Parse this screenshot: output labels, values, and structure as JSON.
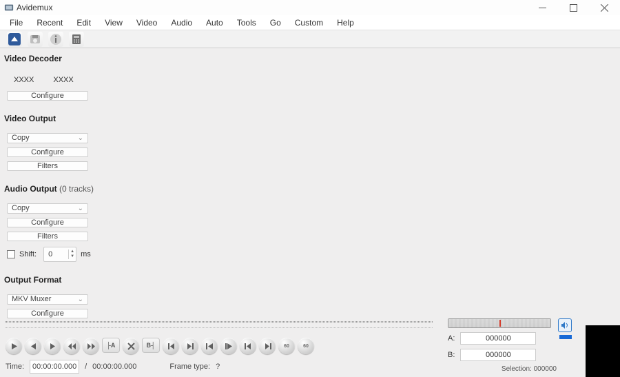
{
  "app": {
    "title": "Avidemux"
  },
  "menu": {
    "file": "File",
    "recent": "Recent",
    "edit": "Edit",
    "view": "View",
    "video": "Video",
    "audio": "Audio",
    "auto": "Auto",
    "tools": "Tools",
    "go": "Go",
    "custom": "Custom",
    "help": "Help"
  },
  "sidebar": {
    "decoder": {
      "title": "Video Decoder",
      "v1": "XXXX",
      "v2": "XXXX",
      "configure": "Configure"
    },
    "vout": {
      "title": "Video Output",
      "select": "Copy",
      "configure": "Configure",
      "filters": "Filters"
    },
    "aout": {
      "title": "Audio Output",
      "tracks": "(0 tracks)",
      "select": "Copy",
      "configure": "Configure",
      "filters": "Filters",
      "shift_label": "Shift:",
      "shift_value": "0",
      "shift_unit": "ms"
    },
    "format": {
      "title": "Output Format",
      "select": "MKV Muxer",
      "configure": "Configure"
    }
  },
  "status": {
    "time_label": "Time:",
    "time_value": "00:00:00.000",
    "duration": "00:00:00.000",
    "frametype_label": "Frame type:",
    "frametype_value": "?"
  },
  "ab": {
    "a_label": "A:",
    "a_value": "000000",
    "b_label": "B:",
    "b_value": "000000",
    "selection": "Selection: 000000"
  }
}
